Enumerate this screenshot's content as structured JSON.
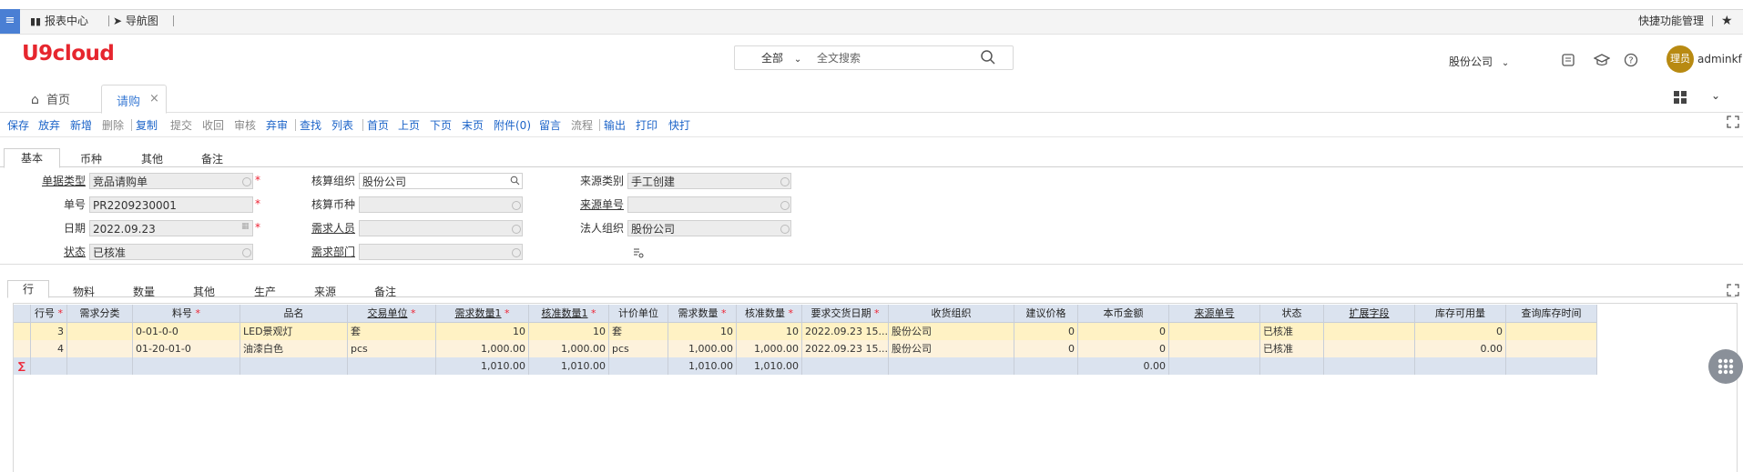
{
  "topbar": {
    "report_center": "报表中心",
    "navigation": "导航图",
    "shortcut_mgmt": "快捷功能管理"
  },
  "header": {
    "logo": "U9cloud",
    "search_scope": "全部",
    "search_placeholder": "全文搜索",
    "company": "股份公司",
    "avatar_text": "理员",
    "username": "adminkf"
  },
  "tabs": {
    "home": "首页",
    "active": "请购"
  },
  "toolbar": [
    "保存",
    "放弃",
    "新增",
    "删除",
    "复制",
    "提交",
    "收回",
    "审核",
    "弃审",
    "查找",
    "列表",
    "首页",
    "上页",
    "下页",
    "末页",
    "附件(0)",
    "留言",
    "流程",
    "输出",
    "打印",
    "快打"
  ],
  "form_tabs": [
    "基本",
    "币种",
    "其他",
    "备注"
  ],
  "form": {
    "doc_type_label": "单据类型",
    "doc_type": "竞品请购单",
    "doc_no_label": "单号",
    "doc_no": "PR2209230001",
    "date_label": "日期",
    "date": "2022.09.23",
    "status_label": "状态",
    "status": "已核准",
    "acct_org_label": "核算组织",
    "acct_org": "股份公司",
    "acct_currency_label": "核算币种",
    "acct_currency": "",
    "requester_label": "需求人员",
    "requester": "",
    "req_dept_label": "需求部门",
    "req_dept": "",
    "source_type_label": "来源类别",
    "source_type": "手工创建",
    "source_no_label": "来源单号",
    "source_no": "",
    "legal_org_label": "法人组织",
    "legal_org": "股份公司"
  },
  "grid_tabs": [
    "行",
    "物料",
    "数量",
    "其他",
    "生产",
    "来源",
    "备注"
  ],
  "grid": {
    "columns": [
      "行号",
      "需求分类",
      "料号",
      "品名",
      "交易单位",
      "需求数量1",
      "核准数量1",
      "计价单位",
      "需求数量",
      "核准数量",
      "要求交货日期",
      "收货组织",
      "建议价格",
      "本币金额",
      "来源单号",
      "状态",
      "扩展字段",
      "库存可用量",
      "查询库存时间"
    ],
    "rows": [
      [
        "3",
        "",
        "0-01-0-0",
        "LED景观灯",
        "套",
        "10",
        "10",
        "套",
        "10",
        "10",
        "2022.09.23 15...",
        "股份公司",
        "0",
        "0",
        "",
        "已核准",
        "",
        "0",
        ""
      ],
      [
        "4",
        "",
        "01-20-01-0",
        "油漆白色",
        "pcs",
        "1,000.00",
        "1,000.00",
        "pcs",
        "1,000.00",
        "1,000.00",
        "2022.09.23 15...",
        "股份公司",
        "0",
        "0",
        "",
        "已核准",
        "",
        "0.00",
        ""
      ]
    ],
    "sum_symbol": "∑",
    "sum": [
      "",
      "",
      "",
      "",
      "",
      "1,010.00",
      "1,010.00",
      "",
      "1,010.00",
      "1,010.00",
      "",
      "",
      "",
      "0.00",
      "",
      "",
      "",
      "",
      ""
    ]
  }
}
